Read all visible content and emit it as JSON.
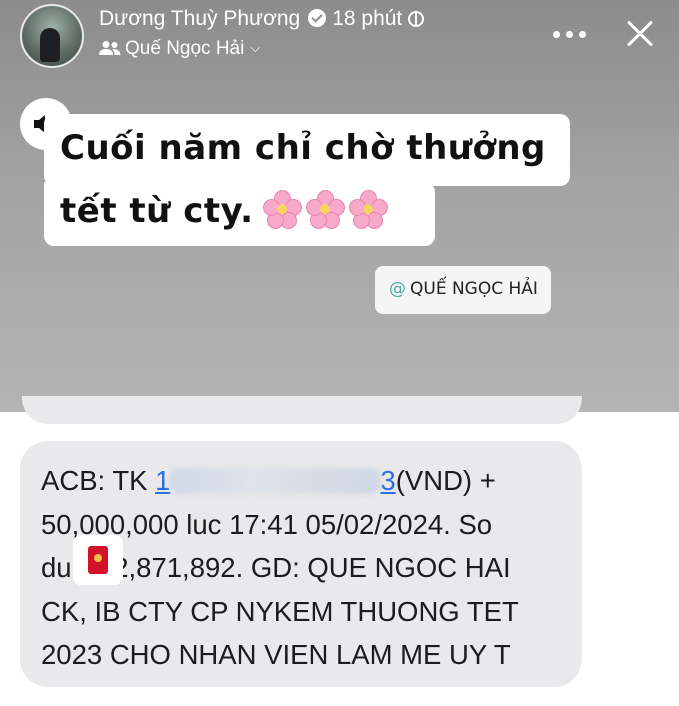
{
  "header": {
    "author_name": "Dương Thuỳ Phương",
    "time_ago": "18 phút",
    "audience": "Quế Ngọc Hải",
    "icons": {
      "verified": "verified-badge-icon",
      "globe": "globe-icon",
      "people": "people-icon",
      "chevron": "chevron-down-icon",
      "more": "more-icon",
      "close": "close-icon"
    }
  },
  "story": {
    "caption_line1": "Cuối năm chỉ chờ thưởng",
    "caption_line2": "tết từ cty.",
    "mention_at": "@",
    "mention_name": "QUẾ NGỌC HẢI",
    "sound_icon": "speaker-icon",
    "flower_icon": "cherry-blossom-icon"
  },
  "sms": {
    "line1_prefix": "ACB: TK ",
    "line1_suffix": "(VND) +",
    "line2": "50,000,000 luc 17:41 05/02/2024. So",
    "line3_prefix": "du ",
    "line3_suffix": "2,871,892. GD: QUE NGOC HAI",
    "line4": "CK, IB CTY CP NYKEM THUONG TET",
    "line5": "2023 CHO NHAN VIEN LAM ME UY T",
    "acct_visible_start": "1",
    "acct_visible_end": "3"
  },
  "colors": {
    "story_bg": "#9a9a9a",
    "sms_bubble": "#e9e9eb",
    "link_blue": "#2c6fe0",
    "envelope_red": "#d3122a"
  }
}
